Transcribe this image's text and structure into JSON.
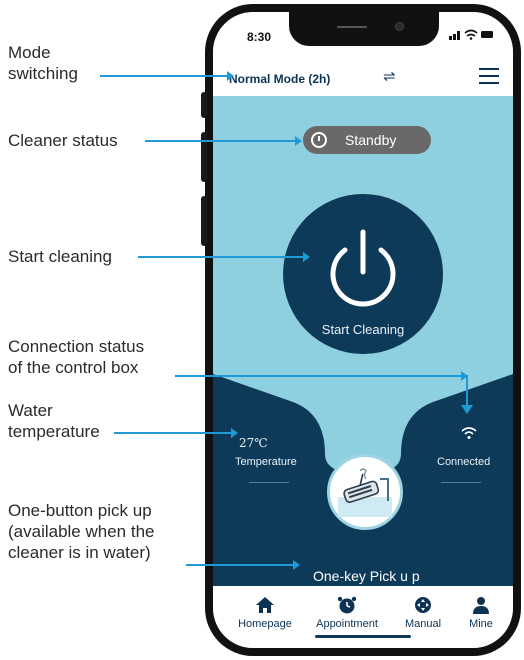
{
  "annotations": {
    "mode": "Mode\nswitching",
    "cleaner_status": "Cleaner status",
    "start": "Start cleaning",
    "connection": "Connection status\nof the control box",
    "water": "Water\ntemperature",
    "pickup": "One-button pick up\n(available when the\ncleaner is in water)"
  },
  "status_bar": {
    "time": "8:30"
  },
  "header": {
    "mode_label": "Normal Mode  (2h)"
  },
  "cleaner": {
    "status": "Standby"
  },
  "start": {
    "label": "Start Cleaning"
  },
  "temperature": {
    "value": "27℃",
    "label": "Temperature"
  },
  "connection": {
    "label": "Connected"
  },
  "pickup": {
    "label": "One-key Pick u p"
  },
  "tabs": [
    {
      "label": "Homepage",
      "icon": "home-icon"
    },
    {
      "label": "Appointment",
      "icon": "alarm-clock-icon"
    },
    {
      "label": "Manual",
      "icon": "joystick-icon"
    },
    {
      "label": "Mine",
      "icon": "user-icon"
    }
  ],
  "colors": {
    "accent": "#1f9ad6",
    "dark_panel": "#0e3a5a",
    "sky_panel": "#8fd0e0",
    "pill": "#696969"
  }
}
